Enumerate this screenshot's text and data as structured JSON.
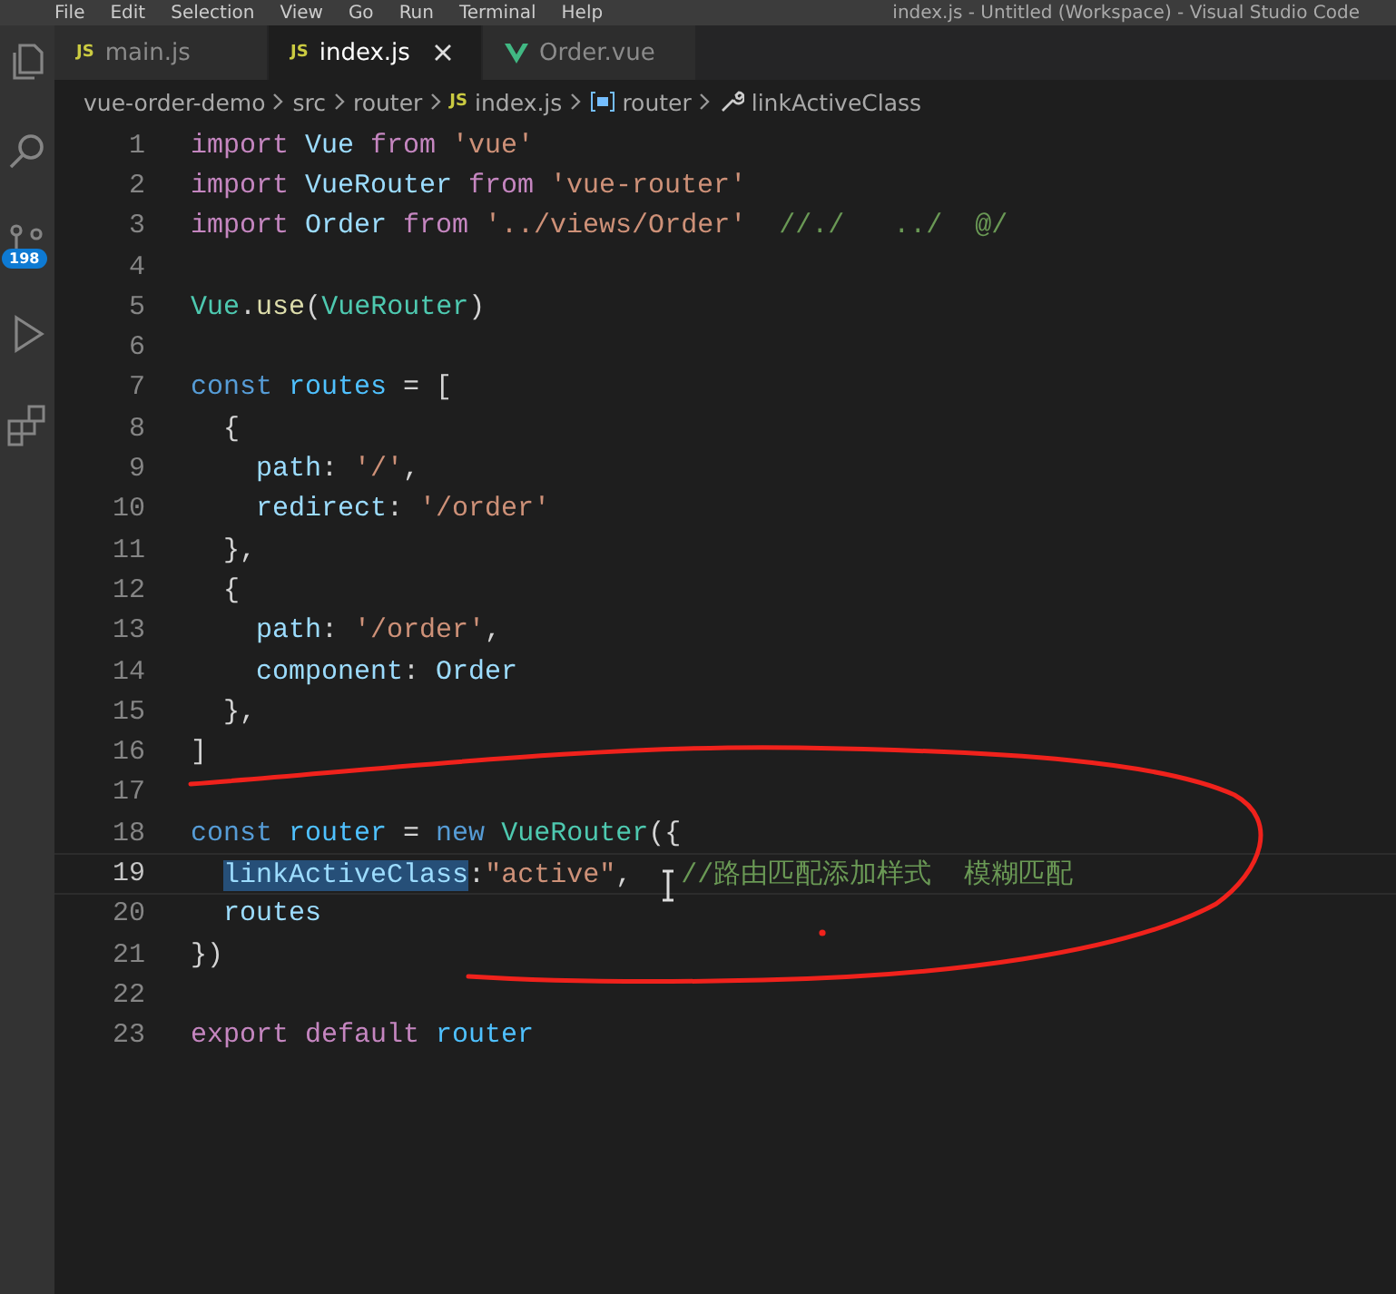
{
  "menu_bar": {
    "items": [
      "File",
      "Edit",
      "Selection",
      "View",
      "Go",
      "Run",
      "Terminal",
      "Help"
    ],
    "title": "index.js - Untitled (Workspace) - Visual Studio Code"
  },
  "activity_bar": {
    "source_control_badge": "198"
  },
  "tabs": [
    {
      "label": "main.js",
      "kind": "js",
      "icon_text": "JS",
      "selected": false
    },
    {
      "label": "index.js",
      "kind": "js",
      "icon_text": "JS",
      "selected": true
    },
    {
      "label": "Order.vue",
      "kind": "vue",
      "selected": false
    }
  ],
  "breadcrumb": [
    {
      "label": "vue-order-demo",
      "kind": "folder"
    },
    {
      "label": "src",
      "kind": "folder"
    },
    {
      "label": "router",
      "kind": "folder"
    },
    {
      "label": "index.js",
      "kind": "js",
      "icon_text": "JS"
    },
    {
      "label": "router",
      "kind": "variable"
    },
    {
      "label": "linkActiveClass",
      "kind": "property"
    }
  ],
  "editor": {
    "lines": [
      {
        "number": "1",
        "current": false,
        "tokens": [
          {
            "kind": "keyword",
            "text": "import "
          },
          {
            "kind": "variable",
            "text": "Vue "
          },
          {
            "kind": "keyword",
            "text": "from "
          },
          {
            "kind": "string",
            "text": "'vue'"
          }
        ]
      },
      {
        "number": "2",
        "current": false,
        "tokens": [
          {
            "kind": "keyword",
            "text": "import "
          },
          {
            "kind": "variable",
            "text": "VueRouter "
          },
          {
            "kind": "keyword",
            "text": "from "
          },
          {
            "kind": "string",
            "text": "'vue-router'"
          }
        ]
      },
      {
        "number": "3",
        "current": false,
        "tokens": [
          {
            "kind": "keyword",
            "text": "import "
          },
          {
            "kind": "variable",
            "text": "Order "
          },
          {
            "kind": "keyword",
            "text": "from "
          },
          {
            "kind": "string",
            "text": "'../views/Order'  "
          },
          {
            "kind": "comment",
            "text": "//./   ../  @/"
          }
        ]
      },
      {
        "number": "4",
        "current": false
      },
      {
        "number": "5",
        "current": false,
        "tokens": [
          {
            "kind": "class",
            "text": "Vue"
          },
          {
            "kind": "plain",
            "text": "."
          },
          {
            "kind": "function",
            "text": "use"
          },
          {
            "kind": "plain",
            "text": "("
          },
          {
            "kind": "class",
            "text": "VueRouter"
          },
          {
            "kind": "plain",
            "text": ")"
          }
        ]
      },
      {
        "number": "6",
        "current": false
      },
      {
        "number": "7",
        "current": false,
        "tokens": [
          {
            "kind": "storage",
            "text": "const "
          },
          {
            "kind": "constant",
            "text": "routes"
          },
          {
            "kind": "plain",
            "text": " = ["
          }
        ]
      },
      {
        "number": "8",
        "current": false,
        "tokens": [
          {
            "kind": "plain",
            "text": "  {"
          }
        ]
      },
      {
        "number": "9",
        "current": false,
        "tokens": [
          {
            "kind": "variable",
            "text": "    path"
          },
          {
            "kind": "plain",
            "text": ": "
          },
          {
            "kind": "string",
            "text": "'/'"
          },
          {
            "kind": "plain",
            "text": ","
          }
        ]
      },
      {
        "number": "10",
        "current": false,
        "tokens": [
          {
            "kind": "variable",
            "text": "    redirect"
          },
          {
            "kind": "plain",
            "text": ": "
          },
          {
            "kind": "string",
            "text": "'/order'"
          }
        ]
      },
      {
        "number": "11",
        "current": false,
        "tokens": [
          {
            "kind": "plain",
            "text": "  },"
          }
        ]
      },
      {
        "number": "12",
        "current": false,
        "tokens": [
          {
            "kind": "plain",
            "text": "  {"
          }
        ]
      },
      {
        "number": "13",
        "current": false,
        "tokens": [
          {
            "kind": "variable",
            "text": "    path"
          },
          {
            "kind": "plain",
            "text": ": "
          },
          {
            "kind": "string",
            "text": "'/order'"
          },
          {
            "kind": "plain",
            "text": ","
          }
        ]
      },
      {
        "number": "14",
        "current": false,
        "tokens": [
          {
            "kind": "variable",
            "text": "    component"
          },
          {
            "kind": "plain",
            "text": ": "
          },
          {
            "kind": "variable",
            "text": "Order"
          }
        ]
      },
      {
        "number": "15",
        "current": false,
        "tokens": [
          {
            "kind": "plain",
            "text": "  },"
          }
        ]
      },
      {
        "number": "16",
        "current": false,
        "tokens": [
          {
            "kind": "plain",
            "text": "]"
          }
        ]
      },
      {
        "number": "17",
        "current": false
      },
      {
        "number": "18",
        "current": false,
        "tokens": [
          {
            "kind": "storage",
            "text": "const "
          },
          {
            "kind": "constant",
            "text": "router"
          },
          {
            "kind": "plain",
            "text": " = "
          },
          {
            "kind": "storage",
            "text": "new "
          },
          {
            "kind": "class",
            "text": "VueRouter"
          },
          {
            "kind": "plain",
            "text": "({"
          }
        ]
      },
      {
        "number": "19",
        "current": true,
        "tokens": [
          {
            "kind": "highlight",
            "text": "  linkActiveClass"
          },
          {
            "kind": "plain",
            "text": ":"
          },
          {
            "kind": "string",
            "text": "\"active\""
          },
          {
            "kind": "plain",
            "text": ",   "
          },
          {
            "kind": "comment",
            "text": "//路由匹配添加样式  模糊匹配"
          }
        ]
      },
      {
        "number": "20",
        "current": false,
        "tokens": [
          {
            "kind": "variable",
            "text": "  routes"
          }
        ]
      },
      {
        "number": "21",
        "current": false,
        "tokens": [
          {
            "kind": "plain",
            "text": "})"
          }
        ]
      },
      {
        "number": "22",
        "current": false
      },
      {
        "number": "23",
        "current": false,
        "tokens": [
          {
            "kind": "keyword",
            "text": "export default "
          },
          {
            "kind": "constant",
            "text": "router"
          }
        ]
      }
    ]
  }
}
